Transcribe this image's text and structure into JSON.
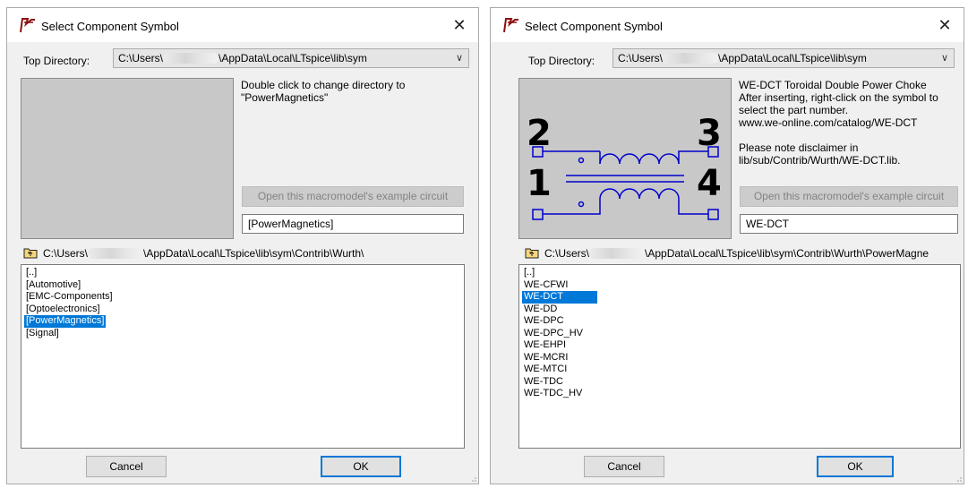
{
  "left_dialog": {
    "title": "Select Component Symbol",
    "close_glyph": "✕",
    "top_directory_label": "Top Directory:",
    "top_directory_prefix": "C:\\Users\\",
    "top_directory_suffix": "\\AppData\\Local\\LTspice\\lib\\sym",
    "description": "Double click to change directory to\n\"PowerMagnetics\"",
    "example_button": "Open this macromodel's example circuit",
    "symbol_field": "[PowerMagnetics]",
    "path_prefix": "C:\\Users\\",
    "path_suffix": "\\AppData\\Local\\LTspice\\lib\\sym\\Contrib\\Wurth\\",
    "items": [
      "[..]",
      "[Automotive]",
      "[EMC-Components]",
      "[Optoelectronics]",
      "[PowerMagnetics]",
      "[Signal]"
    ],
    "selected_index": 4,
    "cancel": "Cancel",
    "ok": "OK"
  },
  "right_dialog": {
    "title": "Select Component Symbol",
    "close_glyph": "✕",
    "top_directory_label": "Top Directory:",
    "top_directory_prefix": "C:\\Users\\",
    "top_directory_suffix": "\\AppData\\Local\\LTspice\\lib\\sym",
    "description": "WE-DCT Toroidal Double Power Choke\nAfter inserting, right-click on the symbol to\nselect the part number.\nwww.we-online.com/catalog/WE-DCT\n\nPlease note disclaimer in\nlib/sub/Contrib/Wurth/WE-DCT.lib.",
    "symbol_pins": [
      "2",
      "3",
      "1",
      "4"
    ],
    "example_button": "Open this macromodel's example circuit",
    "symbol_field": "WE-DCT",
    "path_prefix": "C:\\Users\\",
    "path_suffix": "\\AppData\\Local\\LTspice\\lib\\sym\\Contrib\\Wurth\\PowerMagne",
    "items": [
      "[..]",
      "WE-CFWI",
      "WE-DCT",
      "WE-DD",
      "WE-DPC",
      "WE-DPC_HV",
      "WE-EHPI",
      "WE-MCRI",
      "WE-MTCI",
      "WE-TDC",
      "WE-TDC_HV"
    ],
    "selected_index": 2,
    "cancel": "Cancel",
    "ok": "OK"
  },
  "icons": {
    "app": "ltspice-app-icon",
    "close": "close-icon",
    "dropdown": "chevron-down-icon",
    "folder_up": "folder-up-icon",
    "resize": "resize-grip-icon"
  },
  "colors": {
    "selection": "#0078d7",
    "dialog_bg": "#f0f0f0",
    "preview_bg": "#c8c8c8",
    "symbol_stroke": "#0000cc",
    "disabled_text": "#838383"
  }
}
